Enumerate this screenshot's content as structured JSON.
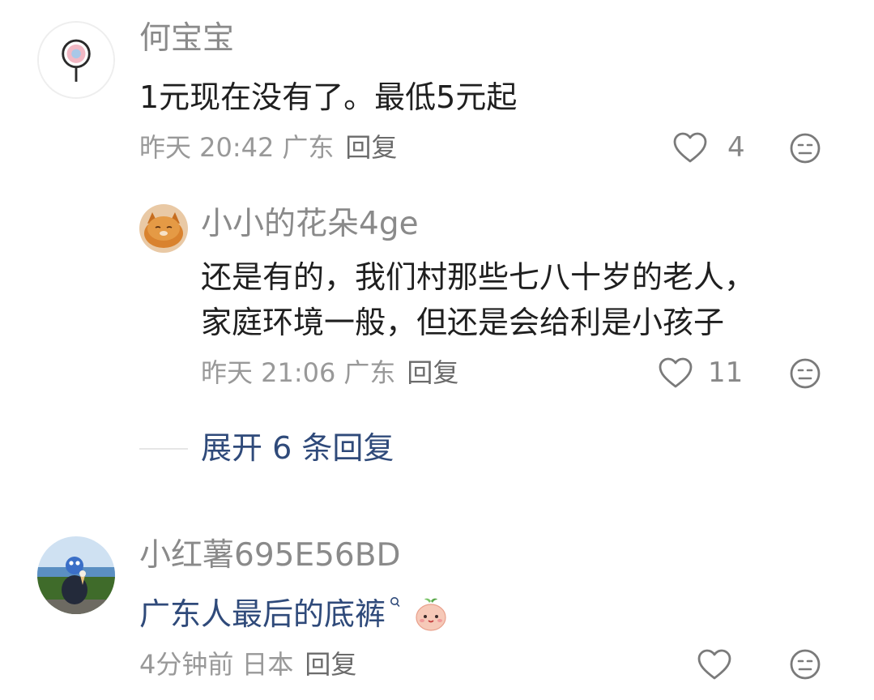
{
  "comments": [
    {
      "username": "何宝宝",
      "content": "1元现在没有了。最低5元起",
      "time": "昨天 20:42",
      "location": "广东",
      "reply_label": "回复",
      "like_count": "4",
      "avatar_icon": "lollipop-avatar"
    },
    {
      "username": "小小的花朵4ge",
      "content_line1": "还是有的，我们村那些七八十岁的老人，",
      "content_line2": "家庭环境一般，但还是会给利是小孩子",
      "time": "昨天 21:06",
      "location": "广东",
      "reply_label": "回复",
      "like_count": "11",
      "avatar_icon": "cat-avatar"
    },
    {
      "username": "小红薯695E56BD",
      "content": "广东人最后的底裤",
      "time": "4分钟前",
      "location": "日本",
      "reply_label": "回复",
      "like_count": "",
      "avatar_icon": "photo-avatar",
      "emoji_icon": "peach-face-emoji"
    }
  ],
  "expand_replies": "展开 6 条回复",
  "colors": {
    "link": "#2f4a7a",
    "meta": "#999999",
    "username": "#8a8a8a",
    "text": "#1f1f1f"
  }
}
